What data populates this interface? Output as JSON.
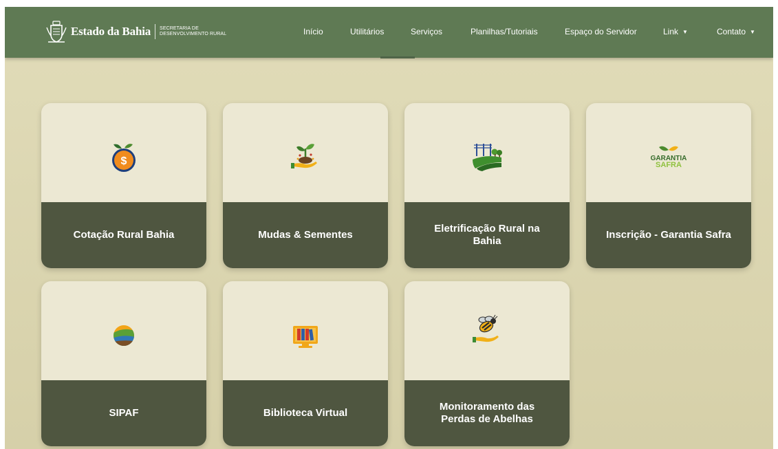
{
  "header": {
    "brand_title": "Estado da Bahia",
    "brand_sub_line1": "SECRETARIA DE",
    "brand_sub_line2": "DESENVOLVIMENTO RURAL",
    "nav": [
      {
        "label": "Início"
      },
      {
        "label": "Utilitários"
      },
      {
        "label": "Serviços"
      },
      {
        "label": "Planilhas/Tutoriais"
      },
      {
        "label": "Espaço do Servidor"
      },
      {
        "label": "Link",
        "dropdown": true
      },
      {
        "label": "Contato",
        "dropdown": true
      }
    ]
  },
  "cards": [
    {
      "label": "Cotação Rural Bahia",
      "icon": "money-bag-leaf-icon"
    },
    {
      "label": "Mudas & Sementes",
      "icon": "seedling-hand-icon"
    },
    {
      "label": "Eletrificação Rural na Bahia",
      "icon": "power-lines-field-icon"
    },
    {
      "label": "Inscrição - Garantia Safra",
      "icon": "garantia-safra-logo",
      "icon_text_1": "GARANTIA",
      "icon_text_2": "SAFRA"
    },
    {
      "label": "SIPAF",
      "icon": "sipaf-landscape-icon"
    },
    {
      "label": "Biblioteca Virtual",
      "icon": "library-monitor-icon"
    },
    {
      "label": "Monitoramento das Perdas de Abelhas",
      "icon": "bee-hand-icon"
    }
  ],
  "colors": {
    "navbar": "#5f7a54",
    "background": "#ddd8b4",
    "card_top": "#ece8d3",
    "card_label": "#4f5640"
  }
}
